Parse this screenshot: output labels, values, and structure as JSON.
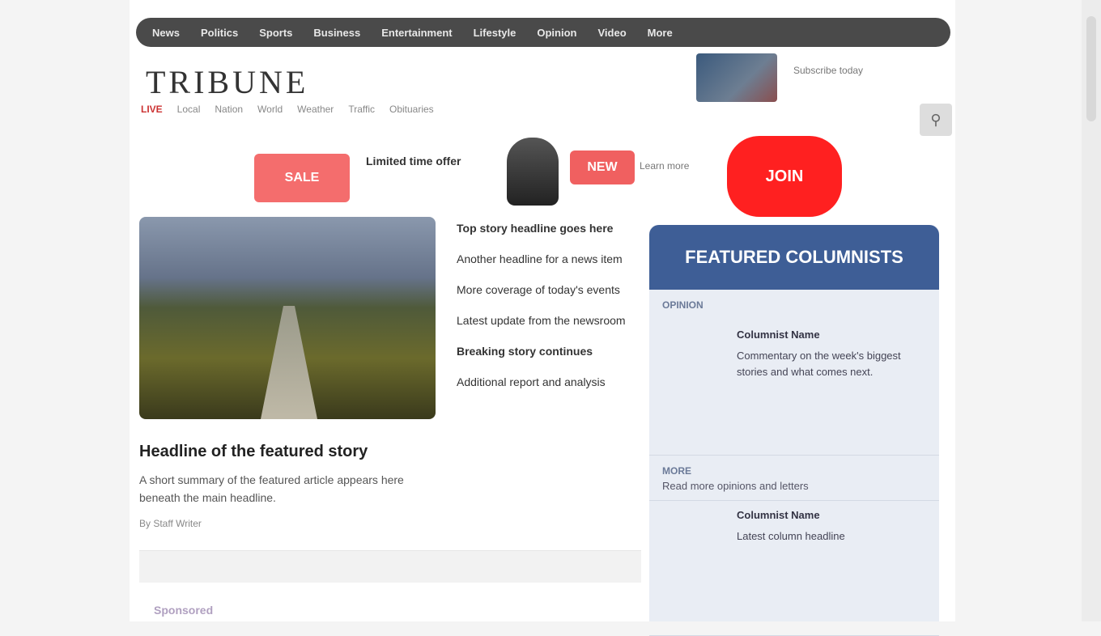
{
  "topbar": {
    "items": [
      "News",
      "Politics",
      "Sports",
      "Business",
      "Entertainment",
      "Lifestyle",
      "Opinion",
      "Video",
      "More"
    ]
  },
  "header": {
    "logo": "TRIBUNE",
    "promo": "Subscribe today",
    "nav": [
      "LIVE",
      "Local",
      "Nation",
      "World",
      "Weather",
      "Traffic",
      "Obituaries"
    ],
    "search_icon": "search-icon"
  },
  "promo": {
    "button_1": "SALE",
    "text_1": "Limited time offer",
    "button_2": "NEW",
    "text_2": "Learn more",
    "cta": "JOIN"
  },
  "feature": {
    "title": "Headline of the featured story",
    "summary": "A short summary of the featured article appears here beneath the main headline.",
    "meta": "By Staff Writer"
  },
  "headlines": [
    {
      "text": "Top story headline goes here",
      "bold": true
    },
    {
      "text": "Another headline for a news item"
    },
    {
      "text": "More coverage of today's events"
    },
    {
      "text": "Latest update from the newsroom"
    },
    {
      "text": "Breaking story continues",
      "bold": true
    },
    {
      "text": "Additional report and analysis"
    }
  ],
  "sidebar": {
    "title": "FEATURED COLUMNISTS",
    "subtitle": "OPINION",
    "cards": [
      {
        "title": "Columnist Name",
        "text": "Commentary on the week's biggest stories and what comes next."
      },
      {
        "title": "Columnist Name",
        "text": "Latest column headline"
      }
    ],
    "section": "MORE",
    "line": "Read more opinions and letters"
  },
  "bottom": {
    "label": "Sponsored"
  },
  "colors": {
    "topbar": "#4a4a4a",
    "accent_red": "#ff2020",
    "sidebar_blue": "#3e5e96"
  }
}
